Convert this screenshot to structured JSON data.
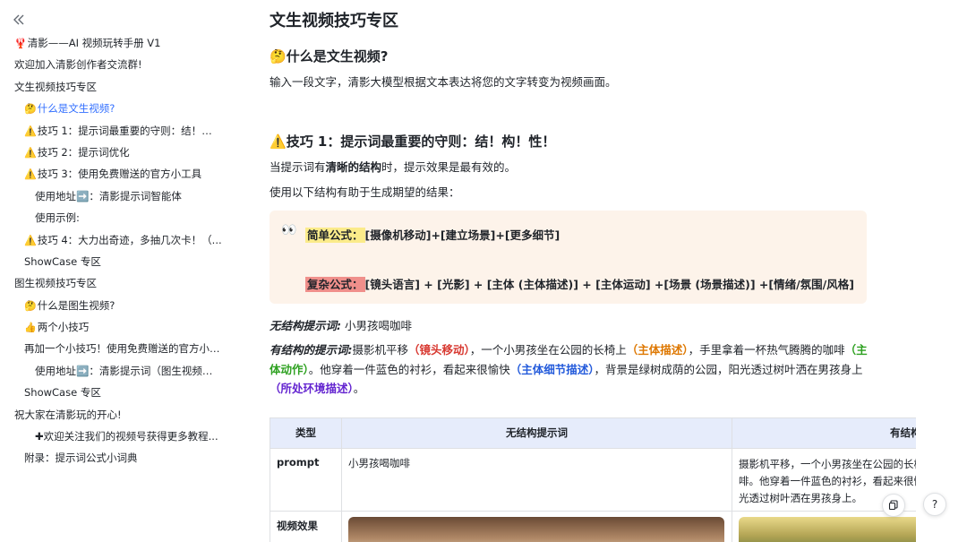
{
  "sidebar": {
    "collapse_icon": "chevrons-left-icon",
    "items": [
      {
        "emoji": "🦞",
        "label": "清影——AI 视频玩转手册 V1",
        "level": 0
      },
      {
        "emoji": "",
        "label": "欢迎加入清影创作者交流群!",
        "level": 0
      },
      {
        "emoji": "",
        "label": "文生视频技巧专区",
        "level": 0
      },
      {
        "emoji": "🤔",
        "label": "什么是文生视频?",
        "level": 1,
        "active": true
      },
      {
        "emoji": "⚠️",
        "label": "技巧 1：提示词最重要的守则：结！构！性！",
        "level": 1
      },
      {
        "emoji": "⚠️",
        "label": "技巧 2：提示词优化",
        "level": 1
      },
      {
        "emoji": "⚠️",
        "label": "技巧 3：使用免费赠送的官方小工具",
        "level": 1
      },
      {
        "emoji": "",
        "label": "使用地址➡️：清影提示词智能体",
        "level": 2
      },
      {
        "emoji": "",
        "label": "使用示例:",
        "level": 2
      },
      {
        "emoji": "⚠️",
        "label": "技巧 4：大力出奇迹，多抽几次卡！（...",
        "level": 1
      },
      {
        "emoji": "",
        "label": "ShowCase 专区",
        "level": 1
      },
      {
        "emoji": "",
        "label": "图生视频技巧专区",
        "level": 0
      },
      {
        "emoji": "🤔",
        "label": "什么是图生视频?",
        "level": 1
      },
      {
        "emoji": "👍",
        "label": "两个小技巧",
        "level": 1
      },
      {
        "emoji": "",
        "label": "再加一个小技巧！使用免费赠送的官方小工具",
        "level": 1
      },
      {
        "emoji": "",
        "label": "使用地址➡️：清影提示词（图生视频专区）",
        "level": 2
      },
      {
        "emoji": "",
        "label": "ShowCase 专区",
        "level": 1
      },
      {
        "emoji": "",
        "label": "祝大家在清影玩的开心!",
        "level": 0
      },
      {
        "emoji": "",
        "label": "✚欢迎关注我们的视频号获得更多教程...",
        "level": 2
      },
      {
        "emoji": "",
        "label": "附录：提示词公式小词典",
        "level": 1
      }
    ]
  },
  "main": {
    "title": "文生视频技巧专区",
    "section1": {
      "emoji": "🤔",
      "heading": "什么是文生视频?",
      "body": "输入一段文字，清影大模型根据文本表达将您的文字转变为视频画面。"
    },
    "section2": {
      "emoji": "⚠️",
      "heading": "技巧 1：提示词最重要的守则：结！构！性！",
      "p1_before": "当提示词有",
      "p1_bold": "清晰的结构",
      "p1_after": "时，提示效果是最有效的。",
      "p2": "使用以下结构有助于生成期望的结果："
    },
    "callout": {
      "eyes": "👀",
      "simple_label": "简单公式：",
      "simple_formula": "[摄像机移动]+[建立场景]+[更多细节]",
      "complex_label": "复杂公式：",
      "complex_formula": "[镜头语言] + [光影] + [主体 (主体描述)] + [主体运动] +[场景 (场景描述)] +[情绪/氛围/风格]"
    },
    "unstructured": {
      "label": "无结构提示词:",
      "text": "小男孩喝咖啡"
    },
    "structured": {
      "label": "有结构的提示词:",
      "t1": "摄影机平移",
      "tag1": "（镜头移动）",
      "t2": "，一个小男孩坐在公园的长椅上",
      "tag2": "（主体描述）",
      "t3": "，手里拿着一杯热气腾腾的咖啡",
      "tag3": "（主体动作）",
      "t4": "。他穿着一件蓝色的衬衫，看起来很愉快",
      "tag4": "（主体细节描述）",
      "t5": "，背景是绿树成荫的公园，阳光透过树叶洒在男孩身上",
      "tag5": "（所处环境描述）",
      "t6": "。"
    },
    "table": {
      "headers": [
        "类型",
        "无结构提示词",
        "有结构"
      ],
      "row1": {
        "label": "prompt",
        "unstructured": "小男孩喝咖啡",
        "structured": "摄影机平移，一个小男孩坐在公园的长椅上，手里拿着一杯热气腾腾的咖啡。他穿着一件蓝色的衬衫，看起来很愉快，背景是绿树成荫的公园，阳光透过树叶洒在男孩身上。"
      },
      "row2": {
        "label": "视频效果"
      }
    }
  },
  "floating": {
    "copy_icon": "copy-link-icon",
    "help_icon": "help-circle-icon",
    "help_glyph": "?"
  },
  "colors": {
    "accent": "#3370ff",
    "callout_bg": "#fdf3ea",
    "highlight_yellow": "#fbeb8a",
    "highlight_red": "#f08f8b",
    "table_header_bg": "#e6ecfb"
  }
}
